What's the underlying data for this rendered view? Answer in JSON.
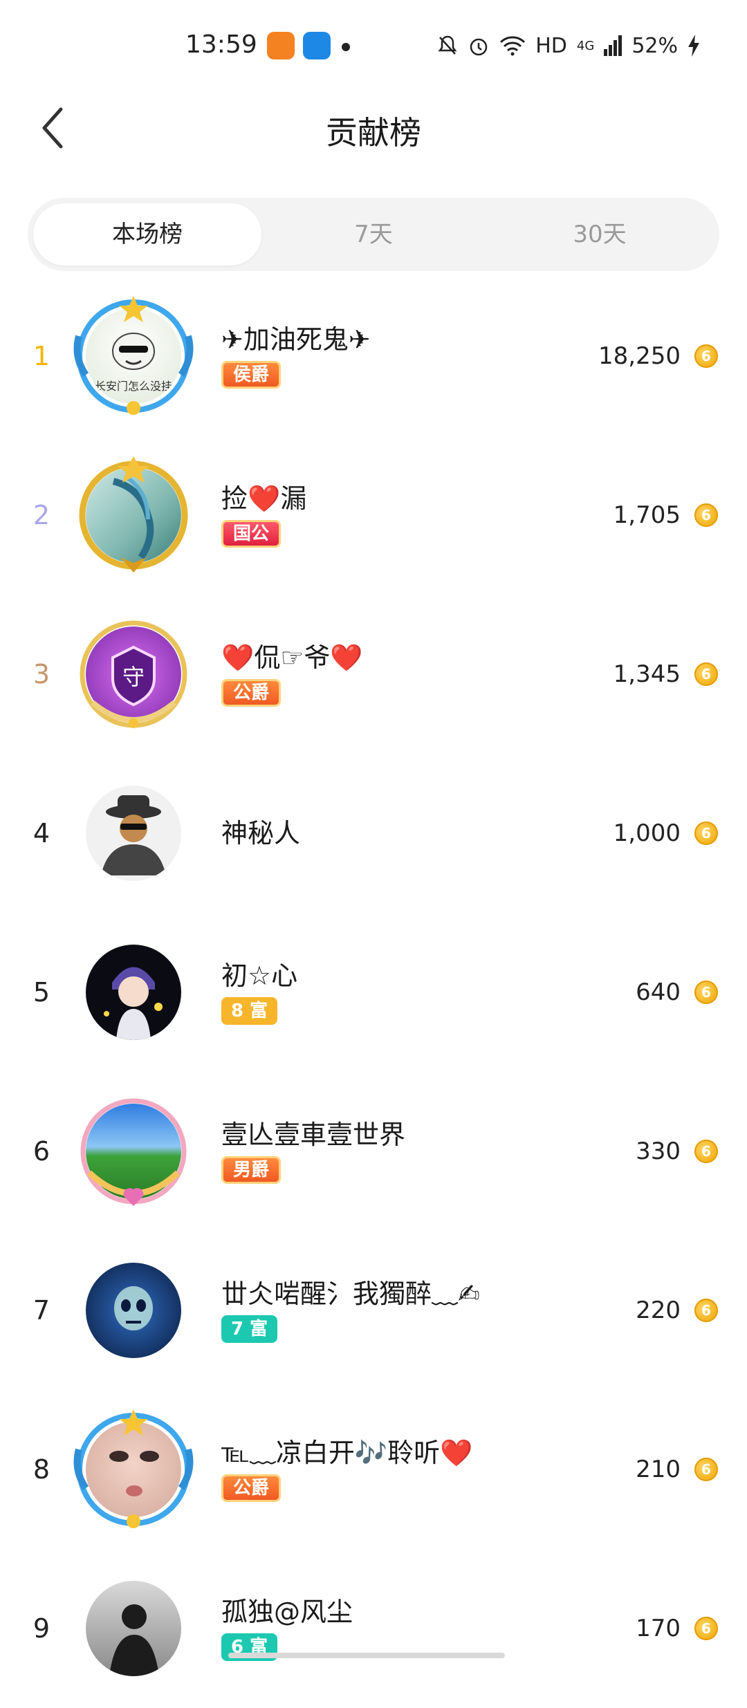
{
  "status_bar": {
    "time": "13:59",
    "network": "HD",
    "signal": "4G",
    "battery": "52%"
  },
  "header": {
    "title": "贡献榜"
  },
  "tabs": [
    {
      "label": "本场榜",
      "active": true
    },
    {
      "label": "7天",
      "active": false
    },
    {
      "label": "30天",
      "active": false
    }
  ],
  "list": [
    {
      "rank": "1",
      "name": "✈加油死鬼✈",
      "badge": "侯爵",
      "score": "18,250"
    },
    {
      "rank": "2",
      "name": "捡❤️漏",
      "badge": "国公",
      "score": "1,705"
    },
    {
      "rank": "3",
      "name": "❤️侃☞爷❤️",
      "badge": "公爵",
      "score": "1,345"
    },
    {
      "rank": "4",
      "name": "神秘人",
      "badge": "",
      "score": "1,000"
    },
    {
      "rank": "5",
      "name": "初☆心",
      "badge": "8 富",
      "score": "640"
    },
    {
      "rank": "6",
      "name": "壹亾壹車壹世界",
      "badge": "男爵",
      "score": "330"
    },
    {
      "rank": "7",
      "name": "丗仌啱醒氵我獨醉﹏✍",
      "badge": "7 富",
      "score": "220"
    },
    {
      "rank": "8",
      "name": "℡﹏凉白开🎶聆听❤️",
      "badge": "公爵",
      "score": "210"
    },
    {
      "rank": "9",
      "name": "孤独@风尘",
      "badge": "6 富",
      "score": "170"
    }
  ],
  "icons": {
    "coin": "coin-icon",
    "back": "chevron-left-icon"
  },
  "colors": {
    "rank1": "#f4b400",
    "rank2": "#a9a7e8",
    "rank3": "#c8956a",
    "noble_badge": "#f05a22",
    "rich_gold": "#f7b52c",
    "rich_teal": "#1cc9b0"
  }
}
